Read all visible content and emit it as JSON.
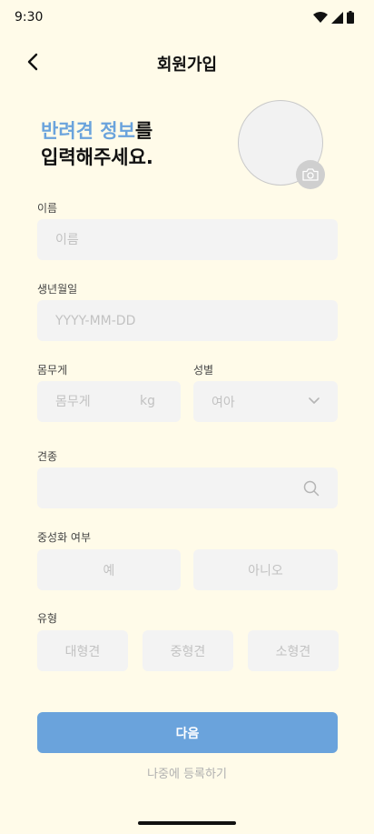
{
  "status": {
    "time": "9:30",
    "icons": [
      "wifi-icon",
      "signal-icon",
      "battery-icon"
    ]
  },
  "header": {
    "title": "회원가입",
    "back_icon": "chevron-left-icon"
  },
  "heading": {
    "highlight": "반려견 정보",
    "suffix": "를",
    "line2": "입력해주세요."
  },
  "form": {
    "name": {
      "label": "이름",
      "placeholder": "이름",
      "value": ""
    },
    "birth": {
      "label": "생년월일",
      "placeholder": "YYYY-MM-DD",
      "value": ""
    },
    "weight": {
      "label": "몸무게",
      "placeholder": "몸무게",
      "unit": "kg",
      "value": ""
    },
    "gender": {
      "label": "성별",
      "selected": "여아"
    },
    "breed": {
      "label": "견종",
      "value": ""
    },
    "neutered": {
      "label": "중성화 여부",
      "options": [
        "예",
        "아니오"
      ]
    },
    "size": {
      "label": "유형",
      "options": [
        "대형견",
        "중형견",
        "소형견"
      ]
    }
  },
  "actions": {
    "next": "다음",
    "later": "나중에 등록하기"
  },
  "colors": {
    "background": "#fffbe9",
    "accent": "#6aa3dc",
    "field": "#f3f3f3"
  }
}
